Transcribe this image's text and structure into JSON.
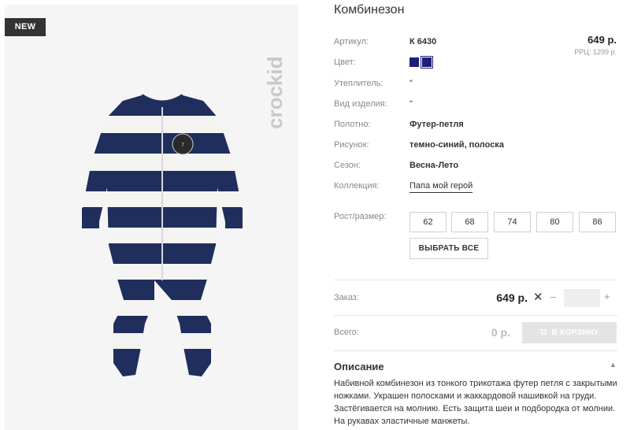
{
  "badge": "NEW",
  "brand": "crockid",
  "product": {
    "title": "Комбинезон",
    "price": "649 р.",
    "rrp": "РРЦ: 1299 р."
  },
  "attributes": {
    "article": {
      "label": "Артикул:",
      "value": "К 6430"
    },
    "color": {
      "label": "Цвет:",
      "swatches": [
        "#1e1e78",
        "#1e1e78"
      ]
    },
    "insulation": {
      "label": "Утеплитель:",
      "value": "\""
    },
    "kind": {
      "label": "Вид изделия:",
      "value": "\""
    },
    "fabric": {
      "label": "Полотно:",
      "value": "Футер-петля"
    },
    "pattern": {
      "label": "Рисунок:",
      "value": "темно-синий, полоска"
    },
    "season": {
      "label": "Сезон:",
      "value": "Весна-Лето"
    },
    "collection": {
      "label": "Коллекция:",
      "value": "Папа мой герой"
    }
  },
  "sizes": {
    "label": "Рост/размер:",
    "options": [
      "62",
      "68",
      "74",
      "80",
      "86"
    ],
    "select_all": "ВЫБРАТЬ ВСЕ"
  },
  "order": {
    "label": "Заказ:",
    "price": "649 р.",
    "remove": "✕",
    "minus": "–",
    "plus": "+",
    "quantity": ""
  },
  "total": {
    "label": "Всего:",
    "value": "0 р.",
    "cart_button": "В КОРЗИНУ"
  },
  "description": {
    "title": "Описание",
    "toggle": "▲",
    "text": "Набивной комбинезон из тонкого трикотажа футер петля с закрытыми ножками. Украшен полосками и жаккардовой нашивкой на груди. Застёгивается на молнию. Есть защита шеи и подбородка от молнии. На рукавах эластичные манжеты."
  },
  "colors": {
    "navy": "#1e1e78",
    "stripe_navy": "#1f2e5c",
    "stripe_white": "#f4f4f2",
    "badge_bg": "#333333",
    "cart_bg": "#e4e4e4"
  }
}
